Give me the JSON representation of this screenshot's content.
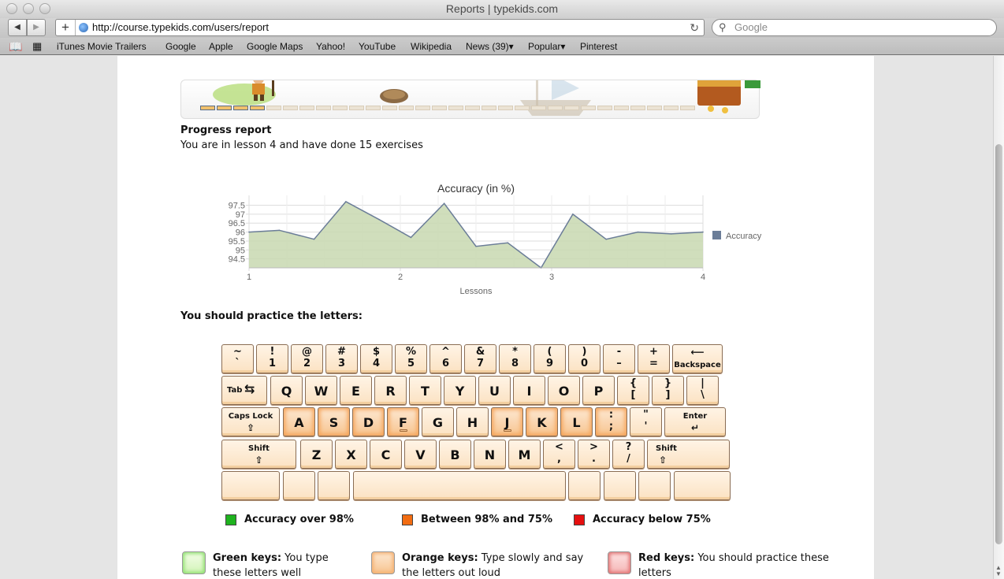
{
  "window": {
    "title": "Reports | typekids.com"
  },
  "toolbar": {
    "back": "◀",
    "forward": "▶",
    "add": "+",
    "url": "http://course.typekids.com/users/report",
    "reload": "↻",
    "search_placeholder": "Google"
  },
  "bookmarks": {
    "items": [
      "iTunes Movie Trailers",
      "Google",
      "Apple",
      "Google Maps",
      "Yahoo!",
      "YouTube",
      "Wikipedia",
      "News (39)▾",
      "Popular▾",
      "Pinterest"
    ]
  },
  "progress": {
    "title": "Progress report",
    "text": "You are in lesson 4 and have done 15 exercises",
    "segments_done": 4,
    "segments_total": 30
  },
  "chart_data": {
    "type": "area",
    "title": "Accuracy (in %)",
    "xlabel": "Lessons",
    "ylabel": "",
    "x_ticks": [
      "1",
      "2",
      "3",
      "4"
    ],
    "y_ticks": [
      "97.5",
      "97",
      "96.5",
      "96",
      "95.5",
      "95",
      "94.5"
    ],
    "ylim": [
      94,
      97.7
    ],
    "xlim": [
      1,
      4
    ],
    "legend_position": "right",
    "series": [
      {
        "name": "Accuracy",
        "color": "#c8d8b0",
        "line_color": "#6b7d98",
        "x": [
          1,
          1.2,
          1.43,
          1.64,
          1.86,
          2.07,
          2.29,
          2.5,
          2.71,
          2.93,
          3.14,
          3.36,
          3.57,
          3.79,
          4
        ],
        "values": [
          96.0,
          96.1,
          95.6,
          97.7,
          96.7,
          95.7,
          97.6,
          95.2,
          95.4,
          94.0,
          97.0,
          95.6,
          96.0,
          95.9,
          96.0
        ]
      }
    ]
  },
  "practice": {
    "title": "You should practice the letters:"
  },
  "keyboard": {
    "row1": [
      {
        "top": "~",
        "bot": "`"
      },
      {
        "top": "!",
        "bot": "1"
      },
      {
        "top": "@",
        "bot": "2"
      },
      {
        "top": "#",
        "bot": "3"
      },
      {
        "top": "$",
        "bot": "4"
      },
      {
        "top": "%",
        "bot": "5"
      },
      {
        "top": "^",
        "bot": "6"
      },
      {
        "top": "&",
        "bot": "7"
      },
      {
        "top": "*",
        "bot": "8"
      },
      {
        "top": "(",
        "bot": "9"
      },
      {
        "top": ")",
        "bot": "0"
      },
      {
        "top": "-",
        "bot": "–"
      },
      {
        "top": "+",
        "bot": "="
      }
    ],
    "backspace": {
      "word": "Backspace",
      "sym": "⟵"
    },
    "tab": {
      "word": "Tab",
      "sym": "⇆"
    },
    "row2": [
      "Q",
      "W",
      "E",
      "R",
      "T",
      "Y",
      "U",
      "I",
      "O",
      "P"
    ],
    "row2_sym": [
      {
        "top": "{",
        "bot": "["
      },
      {
        "top": "}",
        "bot": "]"
      },
      {
        "top": "|",
        "bot": "\\"
      }
    ],
    "capslock": {
      "word": "Caps Lock",
      "sym": "⇪"
    },
    "row3": [
      "A",
      "S",
      "D",
      "F",
      "G",
      "H",
      "J",
      "K",
      "L"
    ],
    "row3_sym": [
      {
        "top": ":",
        "bot": ";"
      },
      {
        "top": "\"",
        "bot": "'"
      }
    ],
    "enter": {
      "word": "Enter",
      "sym": "↵"
    },
    "shift_left": {
      "word": "Shift",
      "sym": "⇧"
    },
    "row4": [
      "Z",
      "X",
      "C",
      "V",
      "B",
      "N",
      "M"
    ],
    "row4_sym": [
      {
        "top": "<",
        "bot": ","
      },
      {
        "top": ">",
        "bot": "."
      },
      {
        "top": "?",
        "bot": "/"
      }
    ],
    "shift_right": {
      "word": "Shift",
      "sym": "⇧"
    }
  },
  "legend": {
    "green": {
      "label": "Accuracy over 98%",
      "color": "#1fb31f"
    },
    "orange": {
      "label": "Between 98% and 75%",
      "color": "#f26c12"
    },
    "red": {
      "label": "Accuracy below 75%",
      "color": "#e60f0f"
    }
  },
  "explain": {
    "green": {
      "bold": "Green keys:",
      "text_line1": " You type",
      "text_line2": "these letters well"
    },
    "orange": {
      "bold": "Orange keys:",
      "text_line1": " Type slowly and say",
      "text_line2": "the letters out loud"
    },
    "red": {
      "bold": "Red keys:",
      "text_line1": " You should practice these",
      "text_line2": "letters"
    }
  }
}
